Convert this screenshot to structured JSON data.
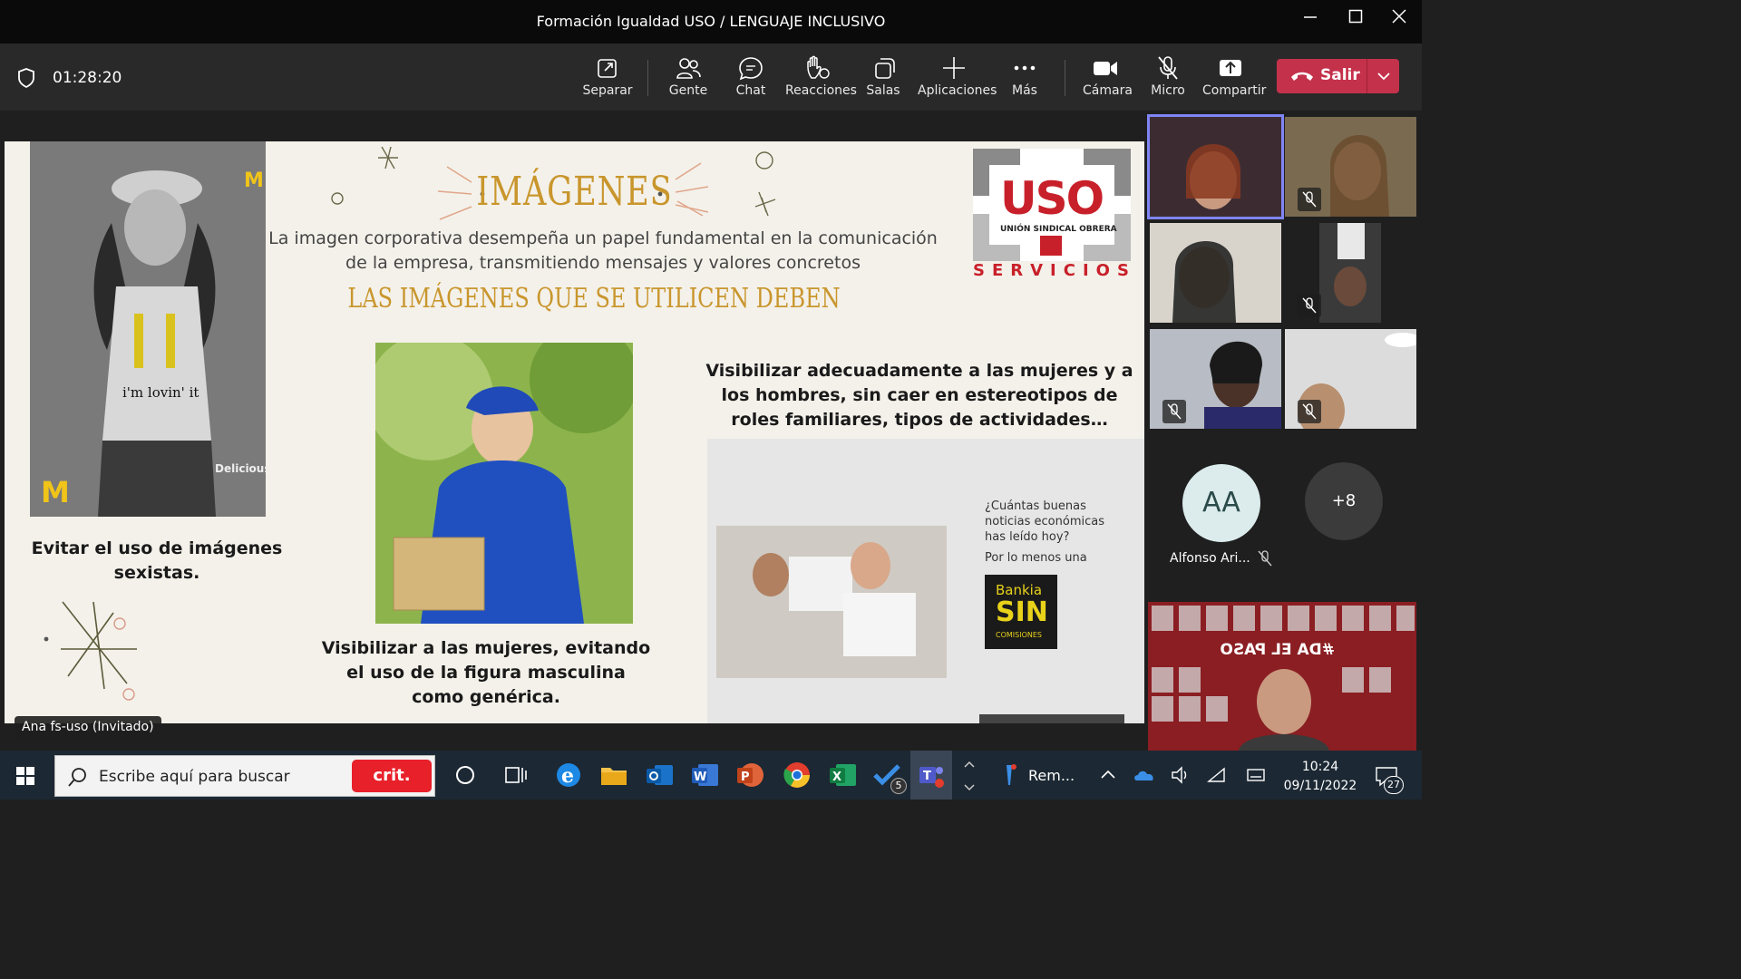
{
  "window": {
    "title": "Formación Igualdad USO / LENGUAJE INCLUSIVO"
  },
  "toolbar": {
    "timer": "01:28:20",
    "buttons": [
      {
        "id": "separar",
        "label": "Separar",
        "icon": "popout-icon"
      },
      {
        "id": "gente",
        "label": "Gente",
        "icon": "people-icon"
      },
      {
        "id": "chat",
        "label": "Chat",
        "icon": "chat-icon"
      },
      {
        "id": "reacciones",
        "label": "Reacciones",
        "icon": "raise-hand-icon"
      },
      {
        "id": "salas",
        "label": "Salas",
        "icon": "breakout-rooms-icon"
      },
      {
        "id": "aplicaciones",
        "label": "Aplicaciones",
        "icon": "plus-icon"
      },
      {
        "id": "mas",
        "label": "Más",
        "icon": "more-icon"
      },
      {
        "id": "camara",
        "label": "Cámara",
        "icon": "camera-icon"
      },
      {
        "id": "micro",
        "label": "Micro",
        "icon": "mic-off-icon"
      },
      {
        "id": "compartir",
        "label": "Compartir",
        "icon": "share-icon"
      }
    ],
    "leave_label": "Salir",
    "accent": "#c4314b"
  },
  "slide": {
    "title": "IMÁGENES",
    "intro": "La imagen corporativa desempeña un papel fundamental en la comunicación de la empresa, transmitiendo mensajes y valores concretos",
    "subtitle": "LAS IMÁGENES QUE SE UTILICEN DEBEN",
    "caption_left": "Evitar el uso de imágenes sexistas.",
    "caption_center": "Visibilizar a las mujeres, evitando el uso de la figura masculina como genérica.",
    "caption_right": "Visibilizar adecuadamente a las mujeres y a los hombres, sin caer en estereotipos de roles familiares, tipos de actividades…",
    "logo": {
      "name": "USO",
      "union": "UNIÓN SINDICAL OBRERA",
      "servicios": "SERVICIOS"
    },
    "ad_mcd": {
      "text": "i'm lovin' it",
      "corner": "Delicious"
    },
    "ad_bankia": {
      "question": "¿Cuántas buenas noticias económicas has leído hoy?",
      "answer": "Por lo menos una",
      "brand": "Bankia",
      "big": "SIN",
      "small": "COMISIONES"
    },
    "colors": {
      "gold": "#c9962d",
      "red": "#c8202a",
      "bg": "#f4f1ea"
    }
  },
  "presenter_name": "Ana fs-uso (Invitado)",
  "participants": {
    "avatar_initials": "AA",
    "avatar_name": "Alfonso Ari...",
    "more_count": "+8",
    "banner_text": "#DA EL PASO"
  },
  "taskbar": {
    "search_placeholder": "Escribe aquí para buscar",
    "crit_label": "crit.",
    "remote_label": "Rem...",
    "todo_badge": "5",
    "time": "10:24",
    "date": "09/11/2022",
    "notifications": "27"
  }
}
